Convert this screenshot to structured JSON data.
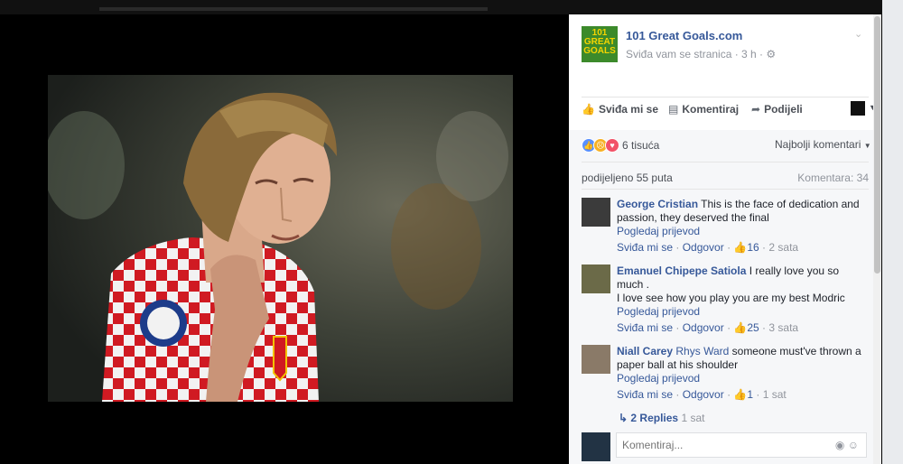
{
  "post": {
    "page_name": "101 Great Goals.com",
    "logo_text": "101 GREAT GOALS",
    "meta": "Sviđa vam se stranica · 3 h · ",
    "privacy_icon": "globe-icon"
  },
  "actions": {
    "like": "Sviđa mi se",
    "comment": "Komentiraj",
    "share": "Podijeli"
  },
  "reactions": {
    "count": "6 tisuća",
    "sort": "Najbolji komentari"
  },
  "stats": {
    "shares": "podijeljeno 55 puta",
    "comments": "Komentara: 34"
  },
  "comments": [
    {
      "name": "George Cristian",
      "tag": "",
      "text": "This is the face of dedication and passion, they deserved the final",
      "translate": "Pogledaj prijevod",
      "like": "Sviđa mi se",
      "reply": "Odgovor",
      "likes": "16",
      "time": "2 sata"
    },
    {
      "name": "Emanuel Chipepe Satiola",
      "tag": "",
      "text": "I really love you so much .",
      "text2": "I love see how you play you are my best Modric",
      "translate": "Pogledaj prijevod",
      "like": "Sviđa mi se",
      "reply": "Odgovor",
      "likes": "25",
      "time": "3 sata"
    },
    {
      "name": "Niall Carey",
      "tag": "Rhys Ward",
      "text": "someone must've thrown a paper ball at his shoulder",
      "translate": "Pogledaj prijevod",
      "like": "Sviđa mi se",
      "reply": "Odgovor",
      "likes": "1",
      "time": "1 sat"
    }
  ],
  "replies": {
    "label": "2 Replies",
    "time": "1 sat"
  },
  "compose": {
    "placeholder": "Komentiraj..."
  }
}
